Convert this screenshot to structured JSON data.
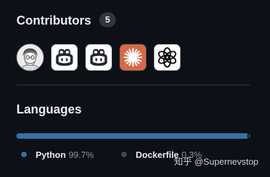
{
  "contributors": {
    "title": "Contributors",
    "count": "5",
    "avatars": [
      {
        "icon": "person-sketch-avatar-icon"
      },
      {
        "icon": "copilot-icon"
      },
      {
        "icon": "copilot-icon"
      },
      {
        "icon": "claude-asterisk-icon"
      },
      {
        "icon": "openai-icon"
      }
    ]
  },
  "languages": {
    "title": "Languages",
    "items": [
      {
        "name": "Python",
        "percent": "99.7%",
        "fraction": 0.997,
        "color": "#3572A5"
      },
      {
        "name": "Dockerfile",
        "percent": "0.3%",
        "fraction": 0.003,
        "color": "#384d54"
      }
    ]
  },
  "watermark": "知乎 @Supernevstop"
}
